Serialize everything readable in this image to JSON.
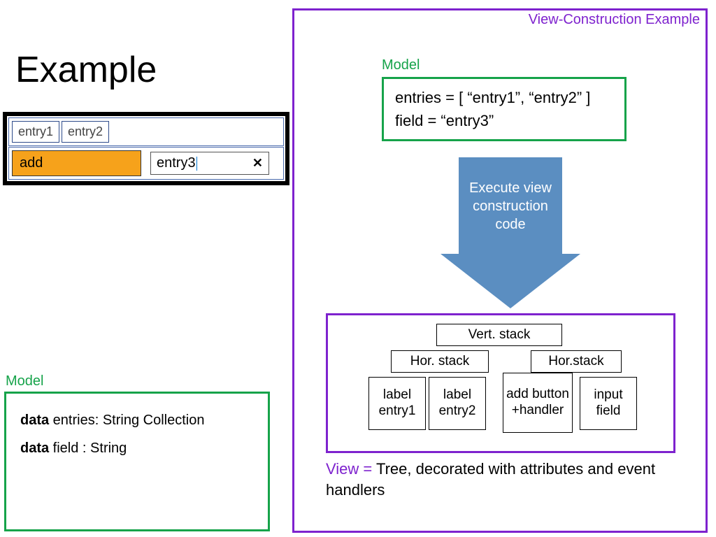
{
  "title": "Example",
  "widget": {
    "entries": [
      "entry1",
      "entry2"
    ],
    "add_label": "add",
    "input_value": "entry3",
    "clear": "✕"
  },
  "left_model": {
    "header": "Model",
    "line1_kw": "data",
    "line1_rest": " entries: String Collection",
    "line2_kw": "data",
    "line2_rest": " field : String"
  },
  "right": {
    "panel_title": "View-Construction Example",
    "model_header": "Model",
    "model_line1": "entries = [ “entry1”, “entry2” ]",
    "model_line2": "field = “entry3”",
    "arrow_text": "Execute view construction code",
    "tree": {
      "root": "Vert. stack",
      "l1a": "Hor. stack",
      "l1b": "Hor.stack",
      "leaf1": "label entry1",
      "leaf2": "label entry2",
      "leaf3": "add button +handler",
      "leaf4": "input field"
    },
    "caption_v": "View = ",
    "caption_rest": "Tree, decorated with attributes and event handlers"
  }
}
